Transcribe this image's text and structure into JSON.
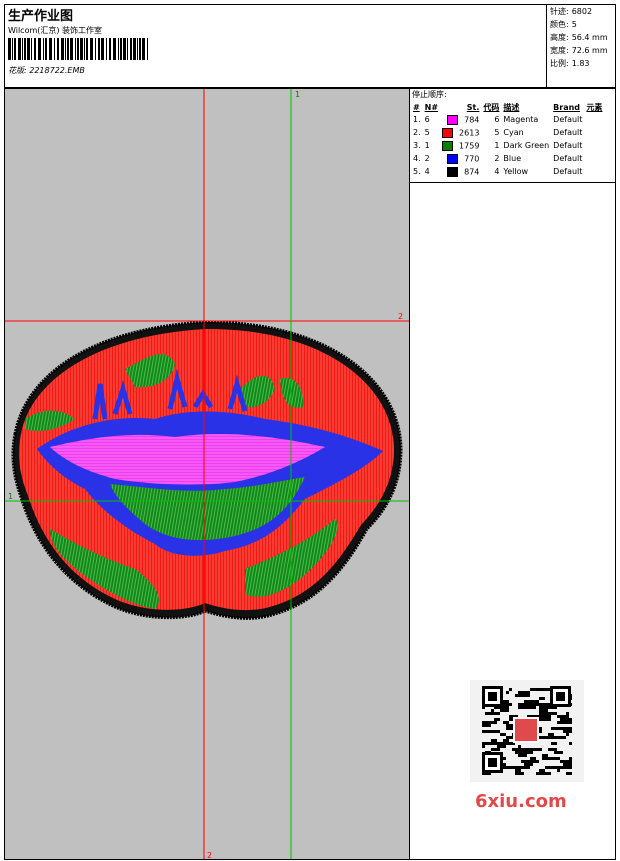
{
  "header": {
    "title": "生产作业图",
    "studio": "Wilcom(汇京) 装饰工作室",
    "design_label": "花版:",
    "design_file": "2218722.EMB"
  },
  "stats": [
    {
      "label": "针迹:",
      "value": "6802"
    },
    {
      "label": "颜色:",
      "value": "5"
    },
    {
      "label": "高度:",
      "value": "56.4 mm"
    },
    {
      "label": "宽度:",
      "value": "72.6 mm"
    },
    {
      "label": "比例:",
      "value": "1.83"
    }
  ],
  "canvas": {
    "marker_top": "1",
    "marker_right": "2",
    "marker_left": "1",
    "marker_bottom": "2"
  },
  "color_panel": {
    "heading": "停止顺序:",
    "columns": [
      "#",
      "N#",
      "St.",
      "代码",
      "描述",
      "Brand",
      "元素"
    ],
    "rows": [
      {
        "idx": "1.",
        "n": "6",
        "color": "#ff00ff",
        "stitches": "784",
        "code": "6",
        "desc": "Magenta",
        "brand": "Default"
      },
      {
        "idx": "2.",
        "n": "5",
        "color": "#ff0000",
        "stitches": "2613",
        "code": "5",
        "desc": "Cyan",
        "brand": "Default"
      },
      {
        "idx": "3.",
        "n": "1",
        "color": "#008000",
        "stitches": "1759",
        "code": "1",
        "desc": "Dark Green",
        "brand": "Default"
      },
      {
        "idx": "4.",
        "n": "2",
        "color": "#0000ff",
        "stitches": "770",
        "code": "2",
        "desc": "Blue",
        "brand": "Default"
      },
      {
        "idx": "5.",
        "n": "4",
        "color": "#000000",
        "stitches": "874",
        "code": "4",
        "desc": "Yellow",
        "brand": "Default"
      }
    ]
  },
  "watermark": "6xiu.com"
}
